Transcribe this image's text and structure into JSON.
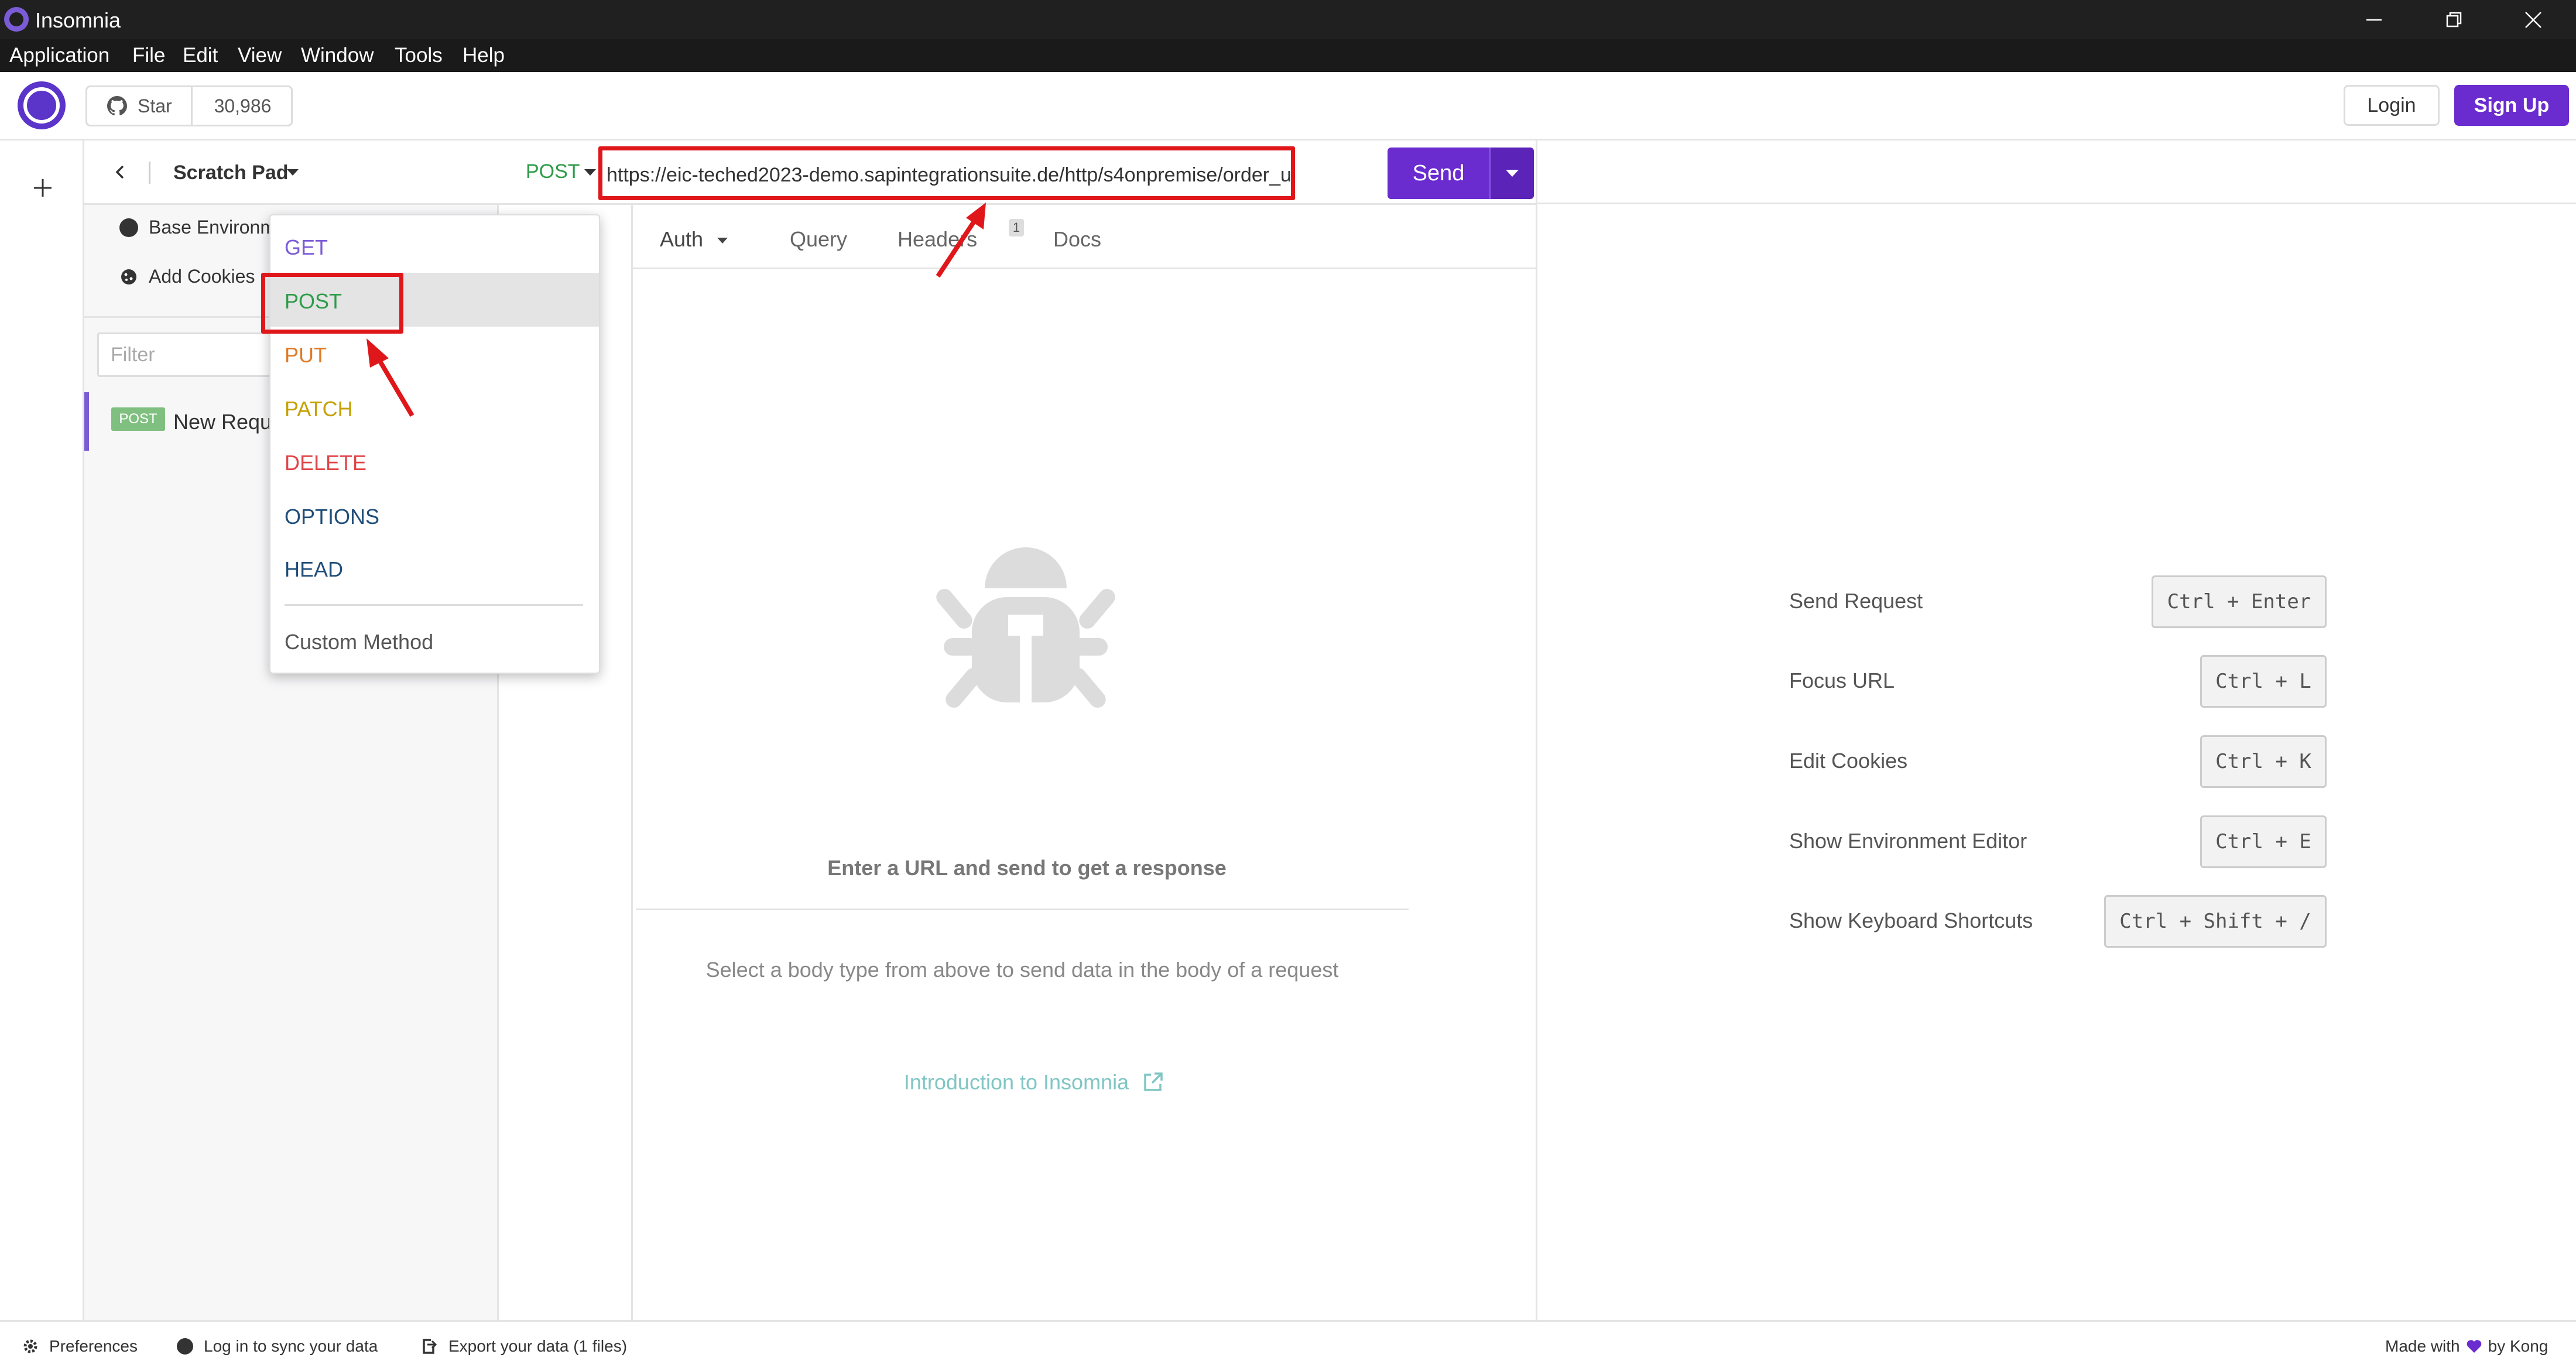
{
  "window": {
    "title": "Insomnia",
    "minimize": "—",
    "restore": "❐",
    "close": "✕"
  },
  "menubar": [
    "Application",
    "File",
    "Edit",
    "View",
    "Window",
    "Tools",
    "Help"
  ],
  "toolbar": {
    "github_star_label": "Star",
    "github_star_count": "30,986",
    "login_label": "Login",
    "signup_label": "Sign Up"
  },
  "sidebar": {
    "title": "Scratch Pad",
    "environment": "Base Environm",
    "cookies": "Add Cookies",
    "filter_placeholder": "Filter",
    "request": {
      "method_badge": "POST",
      "name": "New Requ"
    }
  },
  "request": {
    "method": "POST",
    "url": "https://eic-teched2023-demo.sapintegrationsuite.de/http/s4onpremise/order_u",
    "send_label": "Send",
    "tabs": {
      "auth": "Auth",
      "query": "Query",
      "headers": "Headers",
      "headers_count": "1",
      "docs": "Docs"
    },
    "empty_title": "Enter a URL and send to get a response",
    "empty_sub": "Select a body type from above to send data in the body of a request",
    "intro_link": "Introduction to Insomnia"
  },
  "method_menu": {
    "items": [
      {
        "label": "GET",
        "color": "#7b5cd6"
      },
      {
        "label": "POST",
        "color": "#2e9c4a"
      },
      {
        "label": "PUT",
        "color": "#e07a26"
      },
      {
        "label": "PATCH",
        "color": "#c5a100"
      },
      {
        "label": "DELETE",
        "color": "#e0454a"
      },
      {
        "label": "OPTIONS",
        "color": "#1f4e79"
      },
      {
        "label": "HEAD",
        "color": "#1f4e79"
      }
    ],
    "custom": "Custom Method"
  },
  "shortcuts": [
    {
      "label": "Send Request",
      "keys": "Ctrl + Enter"
    },
    {
      "label": "Focus URL",
      "keys": "Ctrl + L"
    },
    {
      "label": "Edit Cookies",
      "keys": "Ctrl + K"
    },
    {
      "label": "Show Environment Editor",
      "keys": "Ctrl + E"
    },
    {
      "label": "Show Keyboard Shortcuts",
      "keys": "Ctrl + Shift + /"
    }
  ],
  "statusbar": {
    "preferences": "Preferences",
    "sync": "Log in to sync your data",
    "export": "Export your data (1 files)",
    "made_with": "Made with",
    "by": "by Kong"
  },
  "colors": {
    "accent": "#6a2bcf",
    "highlight": "#e0171a",
    "post": "#2e9c4a"
  }
}
